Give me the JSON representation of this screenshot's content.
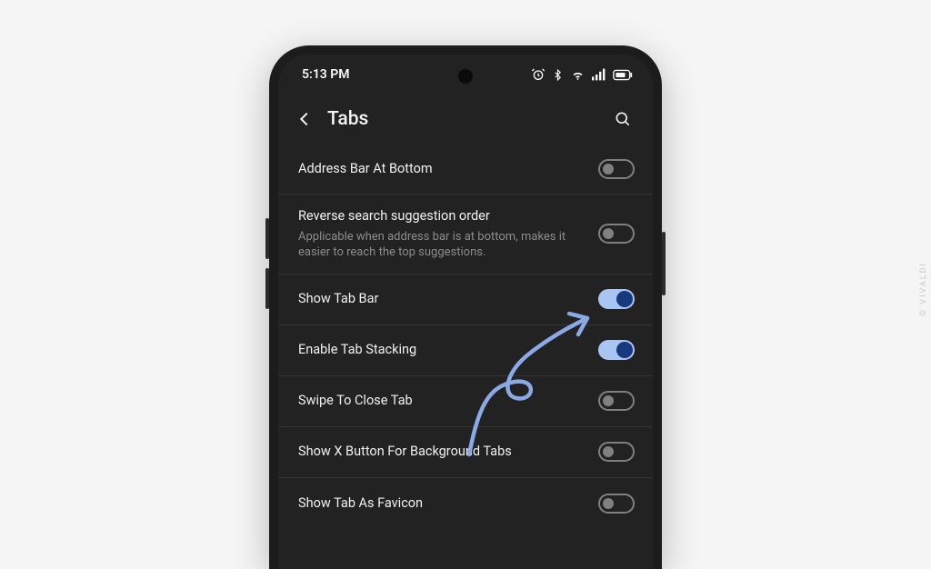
{
  "status": {
    "time": "5:13 PM"
  },
  "appbar": {
    "title": "Tabs"
  },
  "settings": [
    {
      "key": "address_bar_bottom",
      "title": "Address Bar At Bottom",
      "subtitle": "",
      "on": false
    },
    {
      "key": "reverse_suggestions",
      "title": "Reverse search suggestion order",
      "subtitle": "Applicable when address bar is at bottom, makes it easier to reach the top suggestions.",
      "on": false
    },
    {
      "key": "show_tab_bar",
      "title": "Show Tab Bar",
      "subtitle": "",
      "on": true
    },
    {
      "key": "enable_tab_stacking",
      "title": "Enable Tab Stacking",
      "subtitle": "",
      "on": true
    },
    {
      "key": "swipe_close",
      "title": "Swipe To Close Tab",
      "subtitle": "",
      "on": false
    },
    {
      "key": "show_x_bg_tabs",
      "title": "Show X Button For Background Tabs",
      "subtitle": "",
      "on": false
    },
    {
      "key": "show_tab_favicon",
      "title": "Show Tab As Favicon",
      "subtitle": "",
      "on": false
    }
  ],
  "watermark": "© VIVALDI",
  "annotation": {
    "color": "#8aa9e6",
    "target": "show_tab_bar"
  }
}
